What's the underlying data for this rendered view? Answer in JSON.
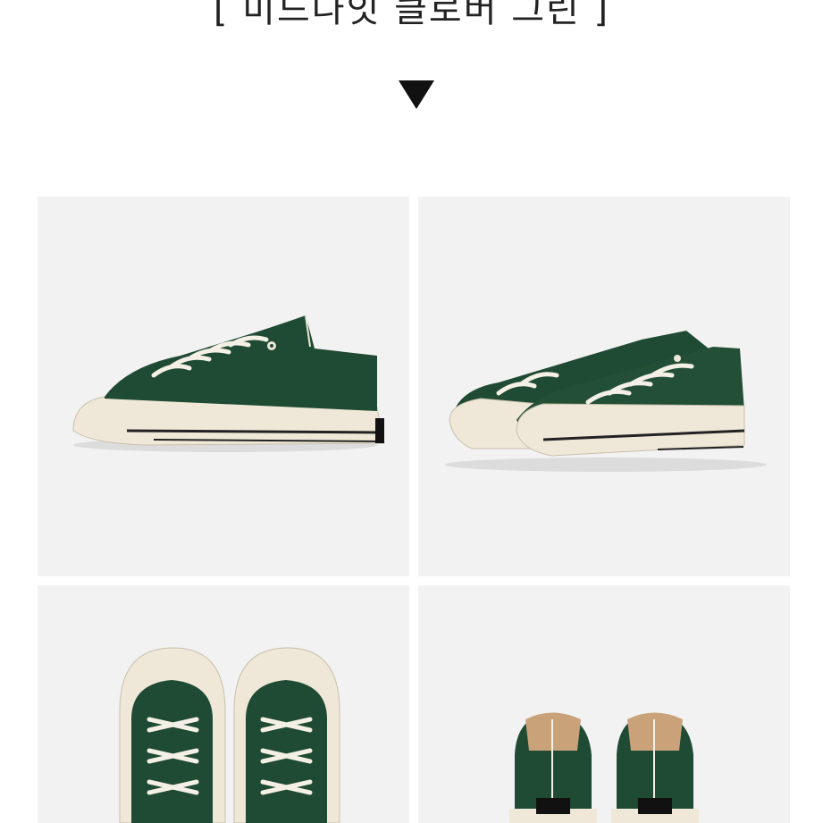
{
  "header": {
    "title": "[ 미드나잇 클로버 그린 ]"
  },
  "gallery": {
    "panel_views": [
      "side",
      "three-quarter",
      "top",
      "back"
    ],
    "accent_color": "#1f4a33",
    "sole_color": "#efe8d8",
    "panel_background": "#f2f2f2"
  }
}
